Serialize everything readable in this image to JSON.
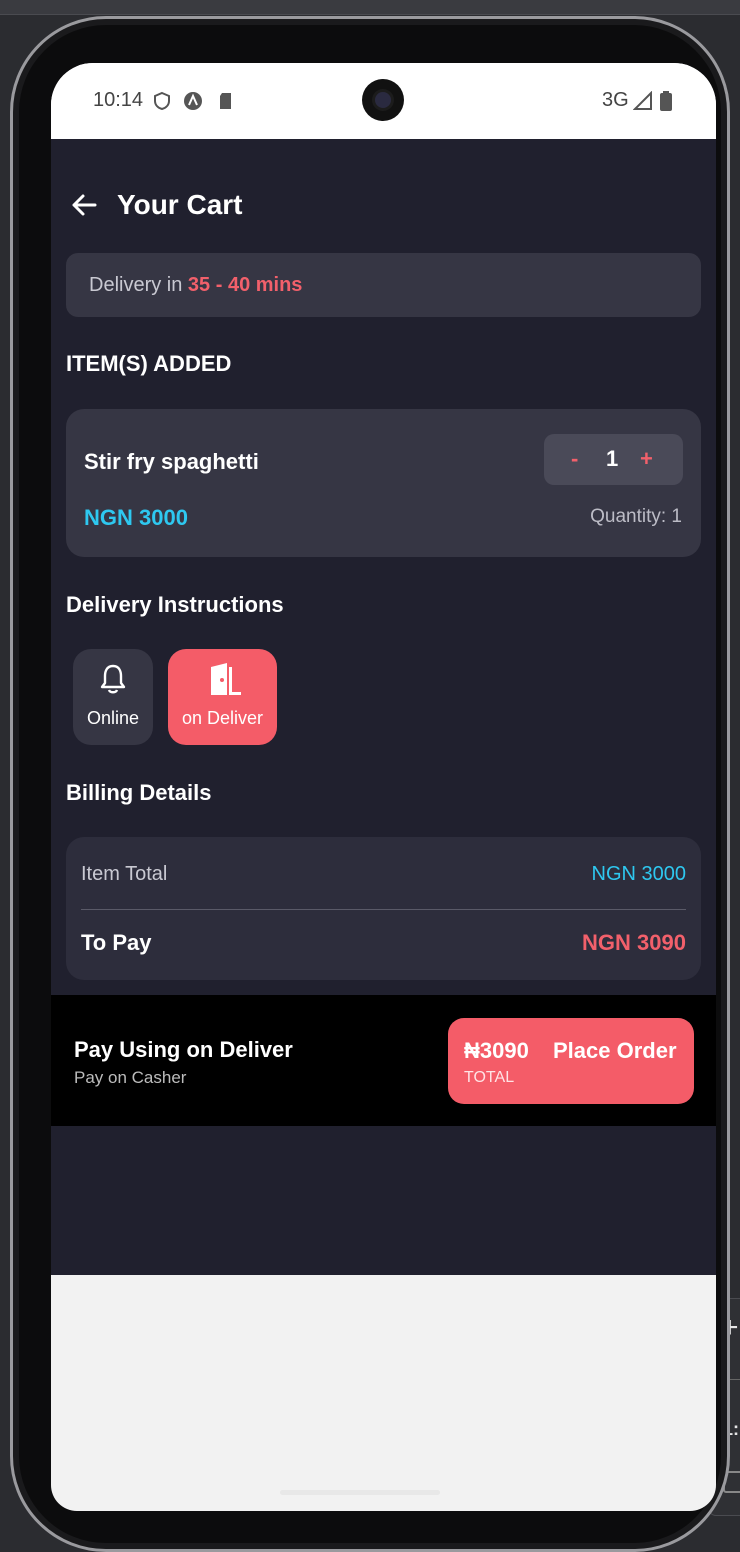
{
  "status_bar": {
    "time": "10:14",
    "network": "3G"
  },
  "header": {
    "title": "Your Cart"
  },
  "delivery": {
    "prefix": "Delivery in ",
    "time": "35 - 40 mins"
  },
  "items_section": {
    "title": "ITEM(S) ADDED"
  },
  "item": {
    "name": "Stir fry spaghetti",
    "price": "NGN 3000",
    "quantity": "1",
    "quantity_label": "Quantity: 1",
    "minus": "-",
    "plus": "+"
  },
  "instructions": {
    "title": "Delivery Instructions",
    "options": [
      {
        "label": "Online",
        "icon": "bell-icon",
        "selected": false
      },
      {
        "label": "on Deliver",
        "icon": "door-icon",
        "selected": true
      }
    ]
  },
  "billing": {
    "title": "Billing Details",
    "item_total_label": "Item Total",
    "item_total_value": "NGN 3000",
    "to_pay_label": "To Pay",
    "to_pay_value": "NGN 3090"
  },
  "payment": {
    "title": "Pay Using on Deliver",
    "subtitle": "Pay on Casher",
    "order_amount": "₦3090",
    "order_label": "Place Order",
    "order_total_label": "TOTAL"
  },
  "colors": {
    "accent": "#f45c68",
    "price": "#2ec8f0",
    "background": "#20202e",
    "card": "#363644"
  }
}
